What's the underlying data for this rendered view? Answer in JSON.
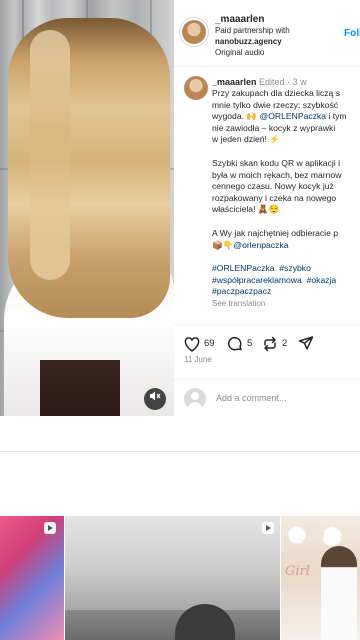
{
  "post": {
    "username": "_maaarlen",
    "paid_partnership": "Paid partnership with",
    "agency": "nanobuzz.agency",
    "audio": "Original audio",
    "follow_label": "Foll"
  },
  "caption": {
    "username": "_maaarlen",
    "meta": "Edited · 3 w",
    "lines": [
      "Przy zakupach dla dziecka liczą s",
      "mnie tylko dwie rzeczy: szybkość",
      "wygoda. 🙌",
      "nie zawiodła – kocyk z wyprawki",
      "w jeden dzień! ⚡",
      "Szybki skan kodu QR w aplikacji i",
      "była w moich rękach, bez marnow",
      "cennego czasu. Nowy kocyk już",
      "rozpakowany i czeka na nowego",
      "właściciela! 🧸😌",
      "A Wy jak najchętniej odbieracie p",
      "📦👇"
    ],
    "mention": "@ORLENPaczka",
    "after_mention": " i tym",
    "mention2": "@orlenpaczka",
    "hashtags_line1": [
      "#ORLENPaczka",
      "#szybko"
    ],
    "hashtags_line2": [
      "#współpracareklamowa",
      "#okazja"
    ],
    "hashtags_line3": [
      "#paczpaczpacz"
    ],
    "see_translation": "See translation"
  },
  "actions": {
    "likes": "69",
    "comments": "5",
    "reposts": "2",
    "date": "11 June"
  },
  "comment_box": {
    "placeholder": "Add a comment..."
  }
}
